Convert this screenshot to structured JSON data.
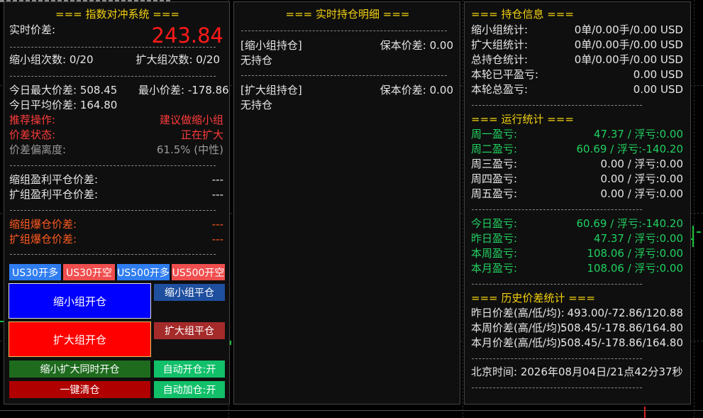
{
  "hedge": {
    "title": "=== 指数对冲系统 ===",
    "realtime_label": "实时价差:",
    "realtime_value": "243.84",
    "shrink_count": "缩小组次数: 0/20",
    "expand_count": "扩大组次数: 0/20",
    "today_max": "今日最大价差: 508.45",
    "today_min": "最小价差: -178.86",
    "today_avg": "今日平均价差: 164.80",
    "recommend_label": "推荐操作:",
    "recommend_value": "建议做缩小组",
    "state_label": "价差状态:",
    "state_value": "正在扩大",
    "deviation_label": "价差偏离度:",
    "deviation_value": "61.5% (中性)",
    "shrink_tp_label": "缩组盈利平仓价差:",
    "shrink_tp_value": "---",
    "expand_tp_label": "扩组盈利平仓价差:",
    "expand_tp_value": "---",
    "shrink_liq_label": "缩组爆仓价差:",
    "shrink_liq_value": "---",
    "expand_liq_label": "扩组爆仓价差:",
    "expand_liq_value": "---"
  },
  "buttons": {
    "us30_long": "US30开多",
    "us30_short": "US30开空",
    "us500_long": "US500开多",
    "us500_short": "US500开空",
    "shrink_open": "缩小组开仓",
    "shrink_close": "缩小组平仓",
    "expand_open": "扩大组开仓",
    "expand_close": "扩大组平仓",
    "both_open": "缩小扩大同时开仓",
    "auto_open": "自动开仓:开",
    "close_all": "一键清仓",
    "auto_add": "自动加仓:开"
  },
  "positions": {
    "title": "=== 实时持仓明细 ===",
    "shrink_header": "[缩小组持仓]",
    "shrink_breakeven": "保本价差: 0.00",
    "shrink_status": "无持仓",
    "expand_header": "[扩大组持仓]",
    "expand_breakeven": "保本价差: 0.00",
    "expand_status": "无持仓"
  },
  "info": {
    "title": "=== 持仓信息 ===",
    "rows": [
      {
        "label": "缩小组统计:",
        "value": "0单/0.00手/0.00 USD"
      },
      {
        "label": "扩大组统计:",
        "value": "0单/0.00手/0.00 USD"
      },
      {
        "label": "总持仓统计:",
        "value": "0单/0.00手/0.00 USD"
      },
      {
        "label": "本轮已平盈亏:",
        "value": "0.00 USD"
      },
      {
        "label": "本轮总盈亏:",
        "value": "0.00 USD"
      }
    ],
    "run_title": "=== 运行统计 ===",
    "weekdays": [
      {
        "label": "周一盈亏:",
        "value": "47.37 / 浮亏:0.00"
      },
      {
        "label": "周二盈亏:",
        "value": "60.69 / 浮亏:-140.20"
      },
      {
        "label": "周三盈亏:",
        "value": "0.00 / 浮亏:0.00"
      },
      {
        "label": "周四盈亏:",
        "value": "0.00 / 浮亏:0.00"
      },
      {
        "label": "周五盈亏:",
        "value": "0.00 / 浮亏:0.00"
      }
    ],
    "periods": [
      {
        "label": "今日盈亏:",
        "value": "60.69 / 浮亏:-140.20"
      },
      {
        "label": "昨日盈亏:",
        "value": "47.37 / 浮亏:0.00"
      },
      {
        "label": "本周盈亏:",
        "value": "108.06 / 浮亏:0.00"
      },
      {
        "label": "本月盈亏:",
        "value": "108.06 / 浮亏:0.00"
      }
    ],
    "history_title": "=== 历史价差统计 ===",
    "history": [
      {
        "label": "昨日价差(高/低/均):",
        "value": "493.00/-72.86/120.88"
      },
      {
        "label": "本周价差(高/低/均):",
        "value": "508.45/-178.86/164.80"
      },
      {
        "label": "本月价差(高/低/均):",
        "value": "508.45/-178.86/164.80"
      }
    ],
    "beijing_time": "北京时间: 2026年08月04日/21点42分37秒"
  },
  "colors": {
    "title": "#f5d30f",
    "realtime_value": "#ff1a1a",
    "warning": "#ff3b3b",
    "profit": "#20d060",
    "btn_blue": "#2f7df0",
    "btn_red": "#f04e4e",
    "btn_shrink_open": "#0000ff",
    "btn_expand_open": "#ff0000",
    "btn_dark_blue": "#1f4f9f",
    "btn_dark_red": "#a52a2a",
    "btn_dark_green": "#1e6b1e",
    "btn_green": "#12c06a",
    "btn_darkred2": "#b00000"
  }
}
